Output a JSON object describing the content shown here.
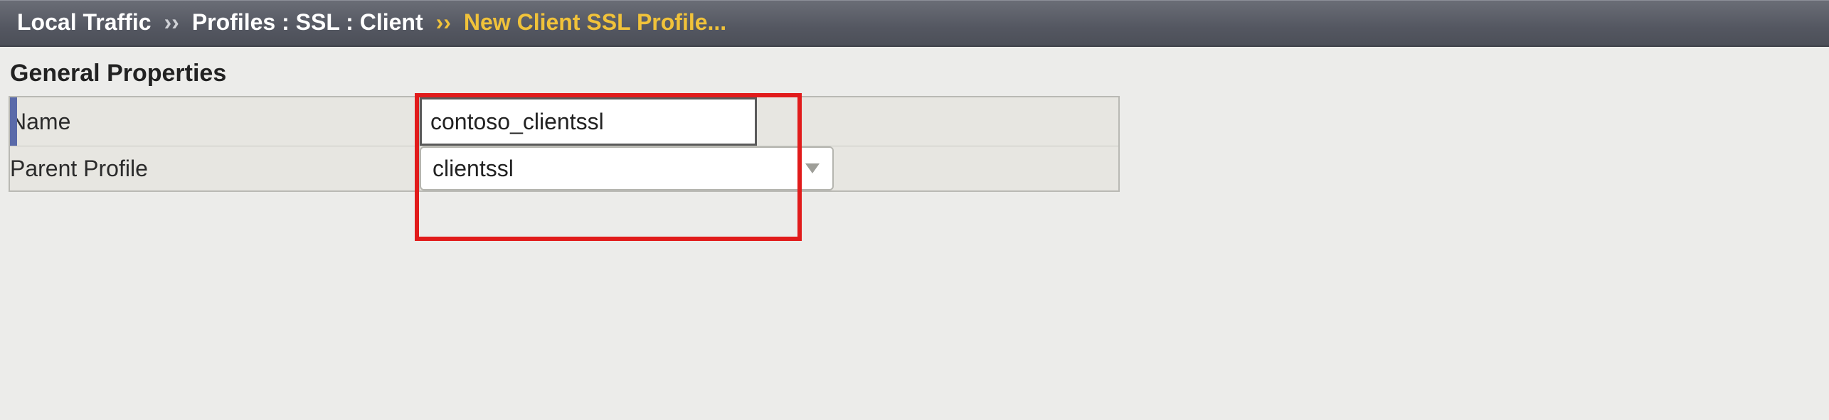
{
  "breadcrumb": {
    "root": "Local Traffic",
    "sep": "››",
    "middle": "Profiles : SSL : Client",
    "leaf": "New Client SSL Profile..."
  },
  "section_title": "General Properties",
  "rows": {
    "name": {
      "label": "Name",
      "value": "contoso_clientssl"
    },
    "parent": {
      "label": "Parent Profile",
      "value": "clientssl"
    }
  }
}
